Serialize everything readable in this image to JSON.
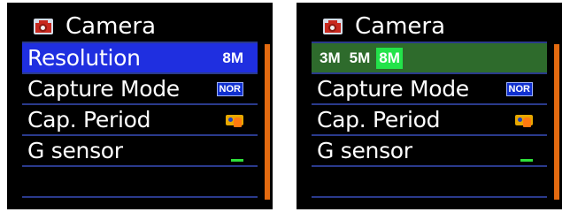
{
  "screens": [
    {
      "title": "Camera",
      "rows": [
        {
          "label": "Resolution",
          "value": "8M"
        },
        {
          "label": "Capture Mode",
          "value": "NOR"
        },
        {
          "label": "Cap. Period",
          "value_icon": "capture-period-icon"
        },
        {
          "label": "G sensor",
          "value_icon": "g-sensor-level-indicator"
        },
        {
          "label": ""
        }
      ],
      "highlighted_row": "Resolution"
    },
    {
      "title": "Camera",
      "resolution_options": [
        "3M",
        "5M",
        "8M"
      ],
      "selected_option": "8M",
      "rows": [
        {
          "label": "Capture Mode",
          "value": "NOR"
        },
        {
          "label": "Cap. Period",
          "value_icon": "capture-period-icon"
        },
        {
          "label": "G sensor",
          "value_icon": "g-sensor-level-indicator"
        },
        {
          "label": ""
        }
      ]
    }
  ],
  "colors": {
    "highlight_blue": "#1f2fe0",
    "highlight_green": "#2e6b2c",
    "selected_option": "#23e34a",
    "scrollbar": "#e36a10",
    "divider": "#2a3a8c"
  }
}
